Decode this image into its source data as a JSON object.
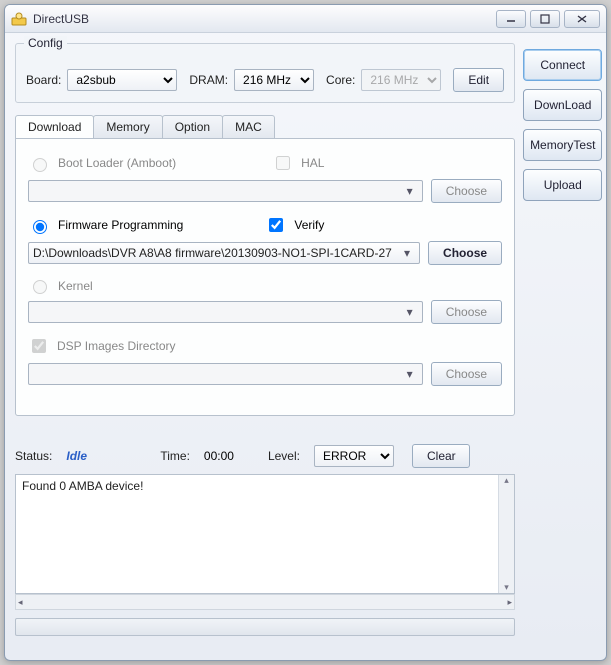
{
  "window": {
    "title": "DirectUSB"
  },
  "config": {
    "legend": "Config",
    "board_label": "Board:",
    "board_value": "a2sbub",
    "dram_label": "DRAM:",
    "dram_value": "216 MHz",
    "core_label": "Core:",
    "core_value": "216 MHz",
    "edit_label": "Edit"
  },
  "tabs": [
    "Download",
    "Memory",
    "Option",
    "MAC"
  ],
  "download": {
    "boot_label": "Boot Loader (Amboot)",
    "hal_label": "HAL",
    "firmware_label": "Firmware Programming",
    "verify_label": "Verify",
    "firmware_path": "D:\\Downloads\\DVR A8\\A8 firmware\\20130903-NO1-SPI-1CARD-27",
    "kernel_label": "Kernel",
    "dsp_label": "DSP Images Directory",
    "choose_label": "Choose"
  },
  "status": {
    "label": "Status:",
    "value": "Idle",
    "time_label": "Time:",
    "time_value": "00:00",
    "level_label": "Level:",
    "level_value": "ERROR",
    "clear_label": "Clear"
  },
  "log": {
    "text": "Found 0 AMBA device!"
  },
  "side": {
    "connect": "Connect",
    "download": "DownLoad",
    "memtest": "MemoryTest",
    "upload": "Upload"
  }
}
